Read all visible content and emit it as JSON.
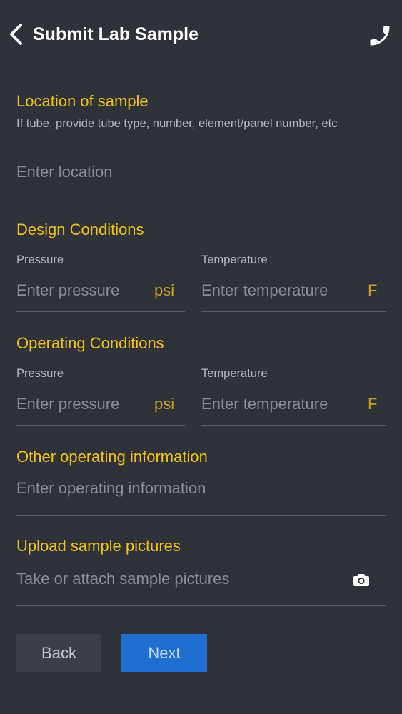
{
  "header": {
    "title": "Submit Lab Sample",
    "back_icon": "chevron-left-icon",
    "call_icon": "phone-icon"
  },
  "location": {
    "title": "Location of sample",
    "hint": "If tube, provide tube type, number, element/panel number, etc",
    "placeholder": "Enter location",
    "value": ""
  },
  "design": {
    "title": "Design Conditions",
    "pressure_label": "Pressure",
    "pressure_placeholder": "Enter pressure",
    "pressure_unit": "psi",
    "temperature_label": "Temperature",
    "temperature_placeholder": "Enter temperature",
    "temperature_unit": "F"
  },
  "operating": {
    "title": "Operating Conditions",
    "pressure_label": "Pressure",
    "pressure_placeholder": "Enter pressure",
    "pressure_unit": "psi",
    "temperature_label": "Temperature",
    "temperature_placeholder": "Enter temperature",
    "temperature_unit": "F"
  },
  "other": {
    "title": "Other operating information",
    "placeholder": "Enter operating information"
  },
  "upload": {
    "title": "Upload sample pictures",
    "placeholder": "Take or attach sample pictures",
    "icon": "camera-icon"
  },
  "buttons": {
    "back": "Back",
    "next": "Next"
  },
  "colors": {
    "background": "#2f3238",
    "accent": "#f0c419",
    "primary_button": "#1f6fd0"
  }
}
